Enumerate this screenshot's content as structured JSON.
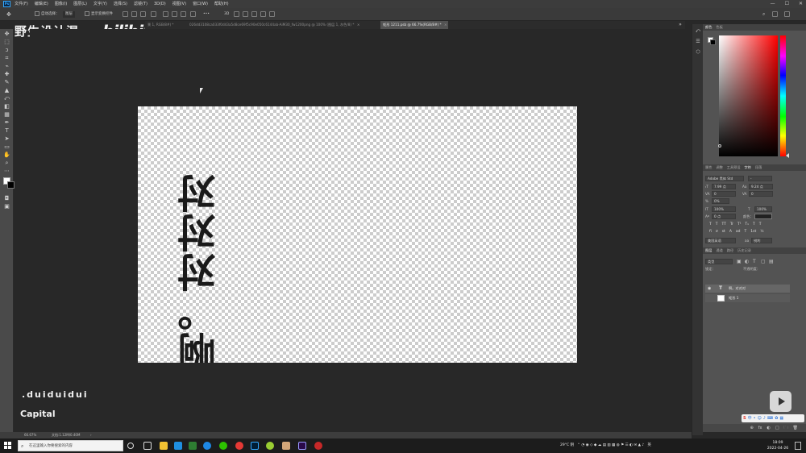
{
  "app": {
    "logo_text": "Ps"
  },
  "menu": [
    "文件(F)",
    "编辑(E)",
    "图像(I)",
    "图层(L)",
    "文字(Y)",
    "选择(S)",
    "滤镜(T)",
    "3D(D)",
    "视图(V)",
    "窗口(W)",
    "帮助(H)"
  ],
  "window_controls": {
    "minimize": "—",
    "maximize": "☐",
    "close": "✕"
  },
  "options_bar": {
    "auto_select": "自动选择：",
    "group_value": "图层",
    "show_transform": "显示变换控件",
    "more": "•••"
  },
  "overlay": {
    "channel_name": "野生设计湿",
    "platform_logo": "bilibili",
    "chip_1": ".duiduidui",
    "chip_2": "Capital"
  },
  "tabs": [
    {
      "label": "景 1, RGB/8#) *",
      "active": false
    },
    {
      "label": "026dd3108ca033f0d43a5d8ce69f5c90e050c6144ab-AiM30_fw1200png @ 100% (图层 1, 灰色/8) *",
      "active": false
    },
    {
      "label": "矩形 1211.psb @ 66.7%(RGB/8#) *",
      "active": true
    }
  ],
  "tab_overflow": "»",
  "document": {
    "vertical_text": "啊。对对对"
  },
  "panels": {
    "color_tabs": [
      "颜色",
      "色板"
    ],
    "character_tabs": [
      "属性",
      "调整",
      "工具预设",
      "字符",
      "段落"
    ],
    "character": {
      "font_family": "Adobe 黑体 Std",
      "font_style": "-",
      "size": "7.99 点",
      "leading": "9.24 点",
      "kerning": "0",
      "tracking": "0",
      "scale_vertical_pct": "0%",
      "scale_v": "100%",
      "scale_h": "100%",
      "baseline": "0 点",
      "color_label": "颜色：",
      "glyphs": [
        "T",
        "T",
        "TT",
        "Tr",
        "T¹",
        "T₁",
        "T",
        "T"
      ],
      "glyphs2": [
        "fi",
        "σ",
        "st",
        "A",
        "ad",
        "T",
        "1st",
        "½"
      ],
      "language": "美国英语",
      "antialias_label": "aa",
      "antialias": "锐利"
    },
    "layers_tabs": [
      "图层",
      "通道",
      "路径",
      "历史记录"
    ],
    "layer_filter": "类型",
    "lock_label": "锁定：",
    "fill_label": "不透明度：",
    "layers": [
      {
        "name": "啊。对对对",
        "kind": "text"
      },
      {
        "name": "矩形 1",
        "kind": "shape"
      }
    ],
    "footer_icons": [
      "⊕",
      "fx",
      "◐",
      "□",
      "🗀",
      "🗑"
    ]
  },
  "status": {
    "zoom": "66.67%",
    "doc_info": "文档:1.12M/0.40M",
    "arrow": "›"
  },
  "taskbar": {
    "search_placeholder": "在这里输入你要搜索的内容",
    "weather": "29°C 阴",
    "ime": "英",
    "time": "18:09",
    "date": "2022-04-26"
  },
  "colors": {
    "accent": "#31a8ff",
    "canvas_bg": "#282828",
    "panel_bg": "#535353",
    "text_color": "#1a1a1a"
  }
}
